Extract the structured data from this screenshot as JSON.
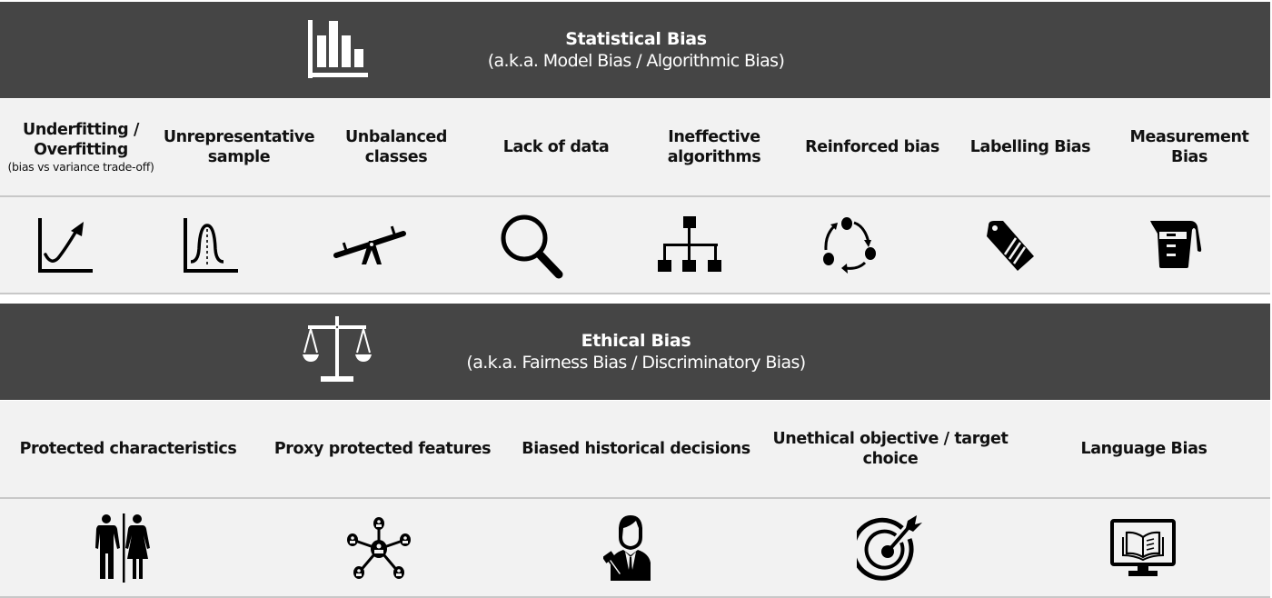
{
  "statistical_bias": {
    "icon": "bar-chart-icon",
    "title": "Statistical Bias",
    "subtitle": "(a.k.a. Model Bias / Algorithmic Bias)",
    "items": [
      {
        "label_line1": "Underfitting /",
        "label_line2": "Overfitting",
        "note": "(bias vs variance trade-off)",
        "icon": "curve-chart-icon"
      },
      {
        "label_line1": "Unrepresentative",
        "label_line2": "sample",
        "note": "",
        "icon": "bell-curve-icon"
      },
      {
        "label_line1": "Unbalanced",
        "label_line2": "classes",
        "note": "",
        "icon": "seesaw-icon"
      },
      {
        "label_line1": "Lack of data",
        "label_line2": "",
        "note": "",
        "icon": "magnifier-icon"
      },
      {
        "label_line1": "Ineffective",
        "label_line2": "algorithms",
        "note": "",
        "icon": "hierarchy-icon"
      },
      {
        "label_line1": "Reinforced bias",
        "label_line2": "",
        "note": "",
        "icon": "cycle-icon"
      },
      {
        "label_line1": "Labelling Bias",
        "label_line2": "",
        "note": "",
        "icon": "tag-icon"
      },
      {
        "label_line1": "Measurement",
        "label_line2": "Bias",
        "note": "",
        "icon": "measuring-jug-icon"
      }
    ]
  },
  "ethical_bias": {
    "icon": "scales-icon",
    "title": "Ethical Bias",
    "subtitle": "(a.k.a. Fairness Bias / Discriminatory Bias)",
    "items": [
      {
        "label_line1": "Protected characteristics",
        "label_line2": "",
        "icon": "man-woman-icon"
      },
      {
        "label_line1": "Proxy protected features",
        "label_line2": "",
        "icon": "network-people-icon"
      },
      {
        "label_line1": "Biased historical decisions",
        "label_line2": "",
        "icon": "judge-icon"
      },
      {
        "label_line1": "Unethical objective / target",
        "label_line2": "choice",
        "icon": "target-icon"
      },
      {
        "label_line1": "Language Bias",
        "label_line2": "",
        "icon": "monitor-book-icon"
      }
    ]
  },
  "colors": {
    "band": "#454545",
    "row": "#f2f2f2",
    "separator": "#c8c8c8",
    "text": "#111111"
  }
}
